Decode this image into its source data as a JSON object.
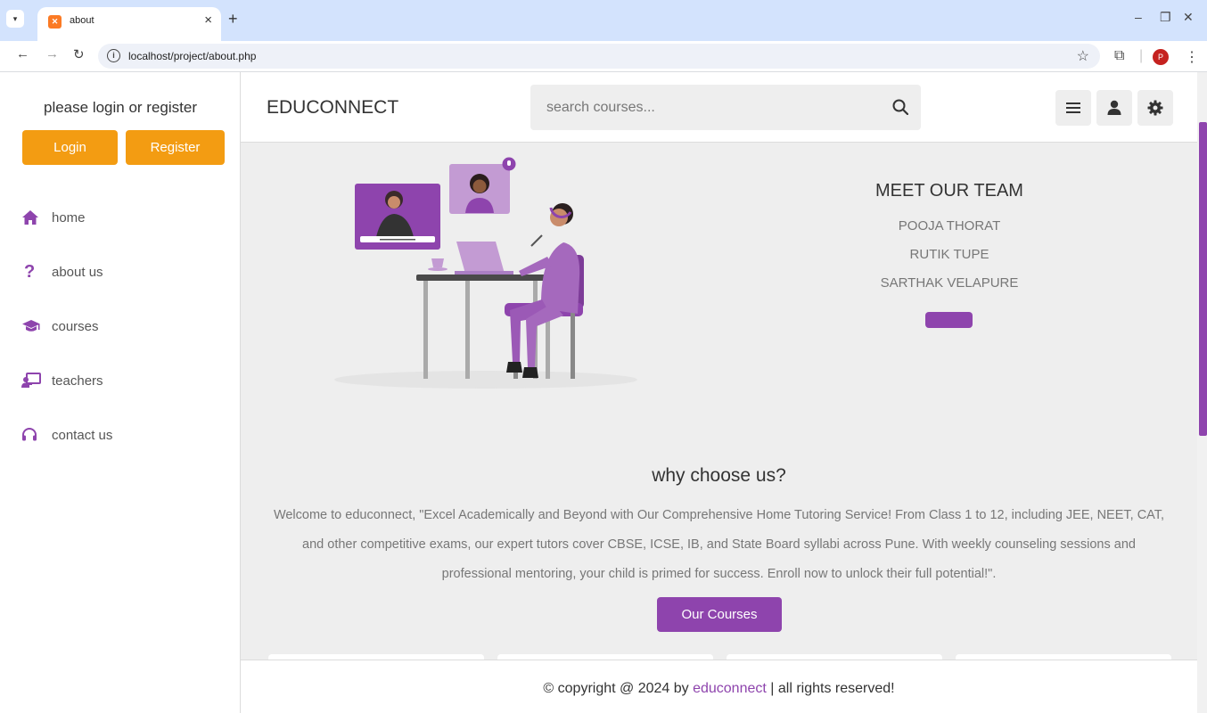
{
  "browser": {
    "tab_title": "about",
    "tab_close": "×",
    "new_tab": "+",
    "url": "localhost/project/about.php",
    "profile_initial": "P",
    "colors": {
      "chrome": "#d3e3fd",
      "profile": "#c5221f"
    }
  },
  "sidebar": {
    "prompt": "please login or register",
    "login_label": "Login",
    "register_label": "Register",
    "items": [
      {
        "label": "home",
        "icon": "home-icon"
      },
      {
        "label": "about us",
        "icon": "question-icon"
      },
      {
        "label": "courses",
        "icon": "graduation-cap-icon"
      },
      {
        "label": "teachers",
        "icon": "chalkboard-teacher-icon"
      },
      {
        "label": "contact us",
        "icon": "headset-icon"
      }
    ]
  },
  "header": {
    "logo": "EDUCONNECT",
    "search_placeholder": "search courses...",
    "buttons": [
      "menu-icon",
      "user-icon",
      "gear-icon"
    ]
  },
  "team": {
    "title": "MEET OUR TEAM",
    "members": [
      "POOJA THORAT",
      "RUTIK TUPE",
      "SARTHAK VELAPURE"
    ]
  },
  "why": {
    "title": "why choose us?",
    "text": "Welcome to educonnect,  \"Excel Academically and Beyond with Our Comprehensive Home Tutoring Service! From Class 1 to 12, including JEE, NEET, CAT, and other competitive exams, our expert tutors cover CBSE, ICSE, IB, and State Board syllabi across Pune. With weekly counseling sessions and professional mentoring, your child is primed for success. Enroll now to unlock their full potential!\".",
    "button_label": "Our Courses"
  },
  "footer": {
    "prefix": "© copyright @ 2024 by ",
    "brand": "educonnect",
    "suffix": " | all rights reserved!"
  },
  "colors": {
    "accent": "#8e44ad",
    "orange": "#f39c12",
    "page_bg": "#eeeeee"
  }
}
